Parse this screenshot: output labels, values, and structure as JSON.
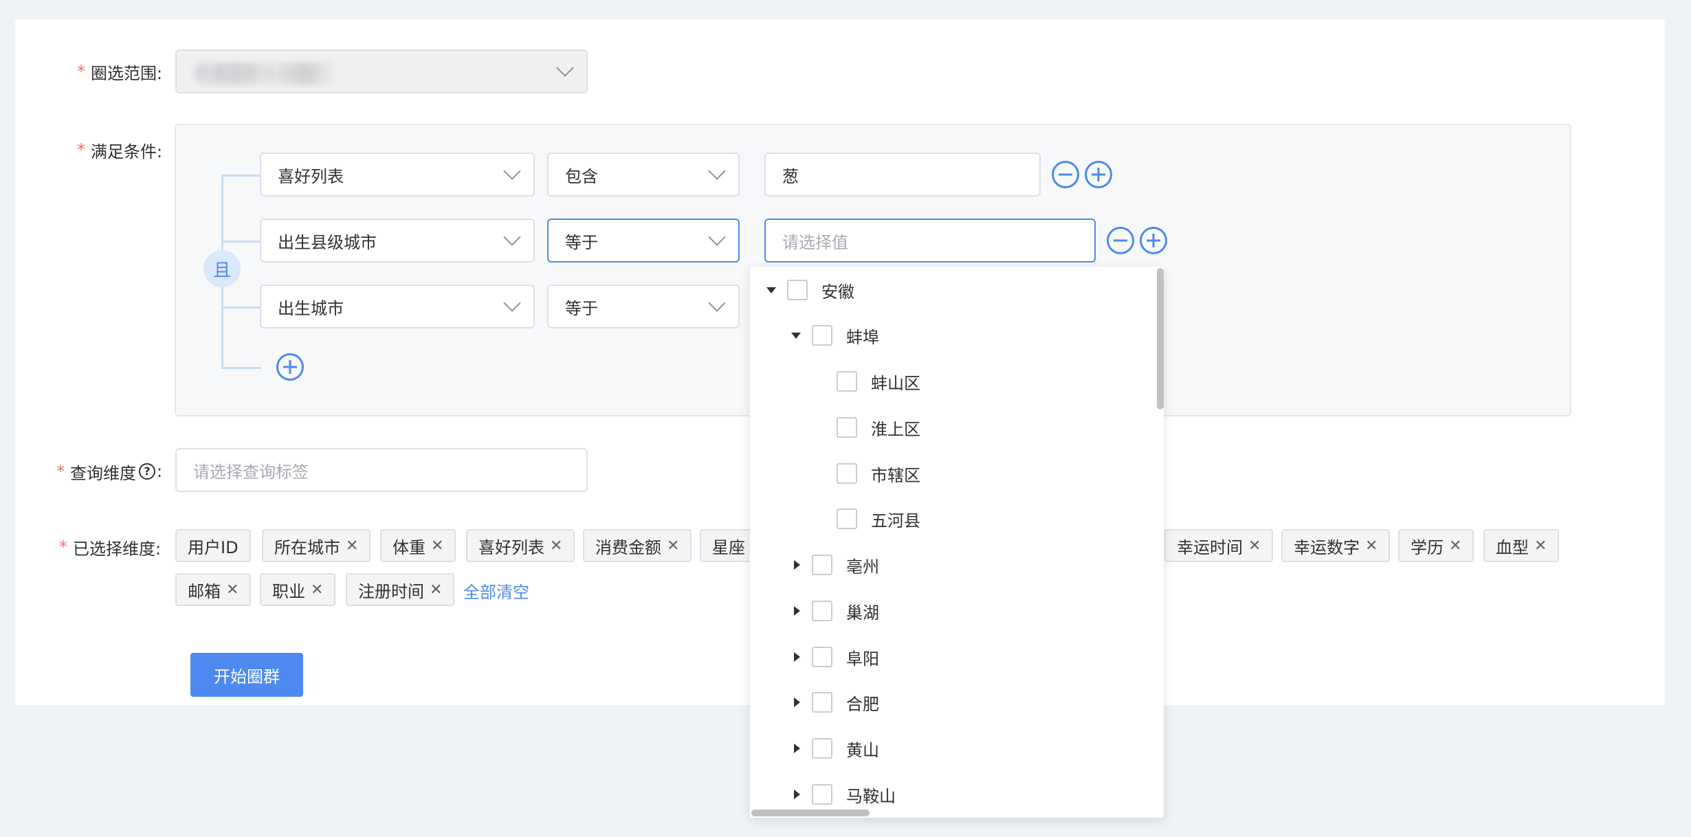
{
  "form": {
    "scope": {
      "label": "圈选范围:",
      "value": "普通文件 0.OOV"
    },
    "condition": {
      "label": "满足条件:",
      "logic": "且"
    },
    "query_dimension": {
      "label": "查询维度",
      "label_suffix": ":",
      "placeholder": "请选择查询标签"
    },
    "selected_dimension": {
      "label": "已选择维度:",
      "clear_all": "全部清空"
    },
    "submit": "开始圈群"
  },
  "conditions": [
    {
      "field": "喜好列表",
      "operator": "包含",
      "value": "葱"
    },
    {
      "field": "出生县级城市",
      "operator": "等于",
      "value_placeholder": "请选择值"
    },
    {
      "field": "出生城市",
      "operator": "等于"
    }
  ],
  "tags_row1": [
    "用户ID",
    "所在城市",
    "体重",
    "喜好列表",
    "消费金额",
    "星座",
    "幸运时间",
    "幸运数字",
    "学历",
    "血型"
  ],
  "tags_row2": [
    "邮箱",
    "职业",
    "注册时间"
  ],
  "tree": [
    {
      "label": "安徽"
    },
    {
      "label": "蚌埠"
    },
    {
      "label": "蚌山区"
    },
    {
      "label": "淮上区"
    },
    {
      "label": "市辖区"
    },
    {
      "label": "五河县"
    },
    {
      "label": "亳州"
    },
    {
      "label": "巢湖"
    },
    {
      "label": "阜阳"
    },
    {
      "label": "合肥"
    },
    {
      "label": "黄山"
    },
    {
      "label": "马鞍山"
    }
  ],
  "colors": {
    "accent": "#4e89e8",
    "required": "#f56c6c"
  }
}
